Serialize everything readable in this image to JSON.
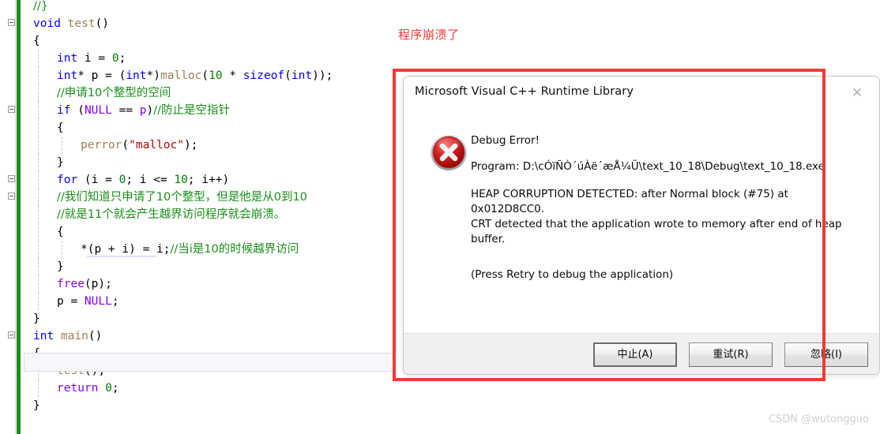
{
  "annotation": {
    "label": "程序崩溃了",
    "color": "#ef3b36"
  },
  "watermark": {
    "text": "CSDN @wutongguo"
  },
  "editor": {
    "language": "c",
    "change_bar_color": "#1a8f1a",
    "lines": [
      {
        "indent": 0,
        "segments": [
          {
            "t": "//}",
            "c": "cmt"
          }
        ]
      },
      {
        "indent": 0,
        "outline": true,
        "segments": [
          {
            "t": "void ",
            "c": "kw"
          },
          {
            "t": "test",
            "c": "fn"
          },
          {
            "t": "()",
            "c": "pun"
          }
        ]
      },
      {
        "indent": 0,
        "segments": [
          {
            "t": "{",
            "c": "pun"
          }
        ]
      },
      {
        "indent": 1,
        "segments": [
          {
            "t": "int ",
            "c": "kw"
          },
          {
            "t": "i ",
            "c": "id"
          },
          {
            "t": "= ",
            "c": "pun"
          },
          {
            "t": "0",
            "c": "num"
          },
          {
            "t": ";",
            "c": "pun"
          }
        ]
      },
      {
        "indent": 1,
        "segments": [
          {
            "t": "int",
            "c": "kw"
          },
          {
            "t": "* p = (",
            "c": "pun"
          },
          {
            "t": "int",
            "c": "kw"
          },
          {
            "t": "*)",
            "c": "pun"
          },
          {
            "t": "malloc",
            "c": "fn"
          },
          {
            "t": "(",
            "c": "pun"
          },
          {
            "t": "10",
            "c": "num"
          },
          {
            "t": " * ",
            "c": "pun"
          },
          {
            "t": "sizeof",
            "c": "kw"
          },
          {
            "t": "(",
            "c": "pun"
          },
          {
            "t": "int",
            "c": "kw"
          },
          {
            "t": "));",
            "c": "pun"
          }
        ]
      },
      {
        "indent": 1,
        "segments": [
          {
            "t": "//申请10个整型的空间",
            "c": "cmt"
          }
        ]
      },
      {
        "indent": 1,
        "outline": true,
        "segments": [
          {
            "t": "if ",
            "c": "kw"
          },
          {
            "t": "(",
            "c": "pun"
          },
          {
            "t": "NULL",
            "c": "kw2"
          },
          {
            "t": " == ",
            "c": "pun"
          },
          {
            "t": "p",
            "c": "kw2"
          },
          {
            "t": ")",
            "c": "pun"
          },
          {
            "t": "//防止是空指针",
            "c": "cmt"
          }
        ]
      },
      {
        "indent": 1,
        "segments": [
          {
            "t": "{",
            "c": "pun"
          }
        ]
      },
      {
        "indent": 2,
        "segments": [
          {
            "t": "perror",
            "c": "fn"
          },
          {
            "t": "(",
            "c": "pun"
          },
          {
            "t": "\"malloc\"",
            "c": "str"
          },
          {
            "t": ");",
            "c": "pun"
          }
        ]
      },
      {
        "indent": 1,
        "segments": [
          {
            "t": "}",
            "c": "pun"
          }
        ]
      },
      {
        "indent": 1,
        "outline": true,
        "segments": [
          {
            "t": "for ",
            "c": "kw"
          },
          {
            "t": "(i = ",
            "c": "pun"
          },
          {
            "t": "0",
            "c": "num"
          },
          {
            "t": "; i <= ",
            "c": "pun"
          },
          {
            "t": "10",
            "c": "num"
          },
          {
            "t": "; i++)",
            "c": "pun"
          }
        ]
      },
      {
        "indent": 1,
        "outline": true,
        "segments": [
          {
            "t": "//我们知道只申请了10个整型，但是他是从0到10",
            "c": "cmt"
          }
        ]
      },
      {
        "indent": 1,
        "segments": [
          {
            "t": "//就是11个就会产生越界访问程序就会崩溃。",
            "c": "cmt"
          }
        ]
      },
      {
        "indent": 1,
        "segments": [
          {
            "t": "{",
            "c": "pun"
          }
        ]
      },
      {
        "indent": 2,
        "squiggle": true,
        "segments": [
          {
            "t": "*(p + i) = i;",
            "c": "pun"
          },
          {
            "t": "//当i是10的时候越界访问",
            "c": "cmt"
          }
        ]
      },
      {
        "indent": 1,
        "segments": [
          {
            "t": "}",
            "c": "pun"
          }
        ]
      },
      {
        "indent": 1,
        "segments": [
          {
            "t": "free",
            "c": "kw2"
          },
          {
            "t": "(p);",
            "c": "pun"
          }
        ]
      },
      {
        "indent": 1,
        "segments": [
          {
            "t": "p = ",
            "c": "pun"
          },
          {
            "t": "NULL",
            "c": "kw2"
          },
          {
            "t": ";",
            "c": "pun"
          }
        ]
      },
      {
        "indent": 0,
        "segments": [
          {
            "t": "}",
            "c": "pun"
          }
        ]
      },
      {
        "indent": 0,
        "outline": true,
        "segments": [
          {
            "t": "int ",
            "c": "kw"
          },
          {
            "t": "main",
            "c": "fn"
          },
          {
            "t": "()",
            "c": "pun"
          }
        ]
      },
      {
        "indent": 0,
        "current": true,
        "segments": [
          {
            "t": "{",
            "c": "pun"
          }
        ]
      },
      {
        "indent": 1,
        "segments": [
          {
            "t": "test",
            "c": "fn"
          },
          {
            "t": "();",
            "c": "pun"
          }
        ]
      },
      {
        "indent": 1,
        "segments": [
          {
            "t": "return ",
            "c": "kw2"
          },
          {
            "t": "0",
            "c": "num"
          },
          {
            "t": ";",
            "c": "pun"
          }
        ]
      },
      {
        "indent": 0,
        "segments": [
          {
            "t": "}",
            "c": "pun"
          }
        ]
      }
    ]
  },
  "dialog": {
    "title": "Microsoft Visual C++ Runtime Library",
    "close_label": "✕",
    "icon": "error-x-icon",
    "messages": {
      "heading": "Debug Error!",
      "program": "Program: D:\\cÓïÑÒ´úÀë´æÅ¼Ü\\text_10_18\\Debug\\text_10_18.exe",
      "detail": "HEAP CORRUPTION DETECTED: after Normal block (#75) at 0x012D8CC0.\nCRT detected that the application wrote to memory after end of heap buffer.",
      "hint": "(Press Retry to debug the application)"
    },
    "buttons": [
      {
        "label": "中止(A)",
        "name": "abort-button",
        "default": true
      },
      {
        "label": "重试(R)",
        "name": "retry-button",
        "default": false
      },
      {
        "label": "忽略(I)",
        "name": "ignore-button",
        "default": false
      }
    ]
  }
}
